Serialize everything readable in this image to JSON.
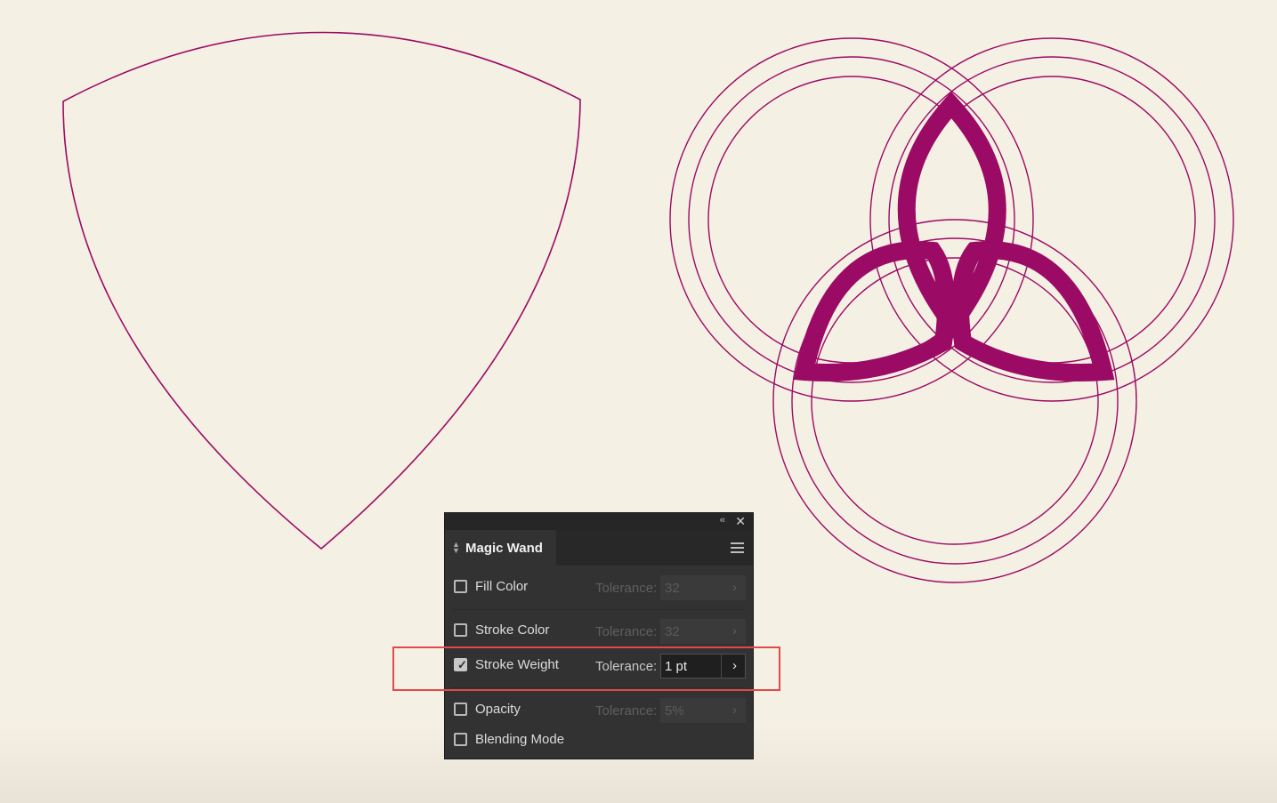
{
  "colors": {
    "canvas_background": "#f5f0e4",
    "artwork_stroke": "#9b0a64",
    "panel_background": "#323232",
    "highlight_box": "#e2494a"
  },
  "panel": {
    "title": "Magic Wand",
    "collapse_icon": "double-chevron-left-icon",
    "close_icon": "close-icon",
    "menu_icon": "hamburger-menu-icon",
    "options": [
      {
        "label": "Fill Color",
        "checked": false,
        "tolerance_label": "Tolerance:",
        "tolerance_value": "32",
        "enabled": false
      },
      {
        "label": "Stroke Color",
        "checked": false,
        "tolerance_label": "Tolerance:",
        "tolerance_value": "32",
        "enabled": false
      },
      {
        "label": "Stroke Weight",
        "checked": true,
        "tolerance_label": "Tolerance:",
        "tolerance_value": "1 pt",
        "enabled": true
      },
      {
        "label": "Opacity",
        "checked": false,
        "tolerance_label": "Tolerance:",
        "tolerance_value": "5%",
        "enabled": false
      },
      {
        "label": "Blending Mode",
        "checked": false
      }
    ]
  }
}
